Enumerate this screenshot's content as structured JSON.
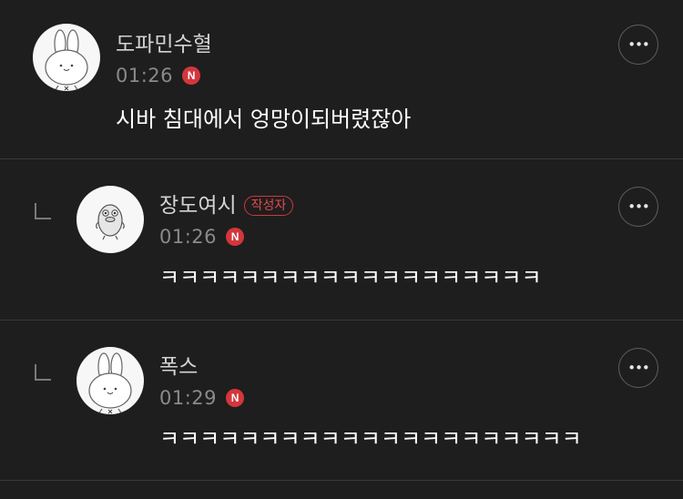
{
  "comments": [
    {
      "author": "도파민수혈",
      "time": "01:26",
      "badge": "N",
      "text": "시바 침대에서 엉망이되버렸잖아",
      "avatar": "bunny-avatar",
      "more_icon": "•••"
    },
    {
      "author": "장도여시",
      "author_tag": "작성자",
      "time": "01:26",
      "badge": "N",
      "text": "ㅋㅋㅋㅋㅋㅋㅋㅋㅋㅋㅋㅋㅋㅋㅋㅋㅋㅋㅋ",
      "avatar": "duck-avatar",
      "more_icon": "•••"
    },
    {
      "author": "폭스",
      "time": "01:29",
      "badge": "N",
      "text": "ㅋㅋㅋㅋㅋㅋㅋㅋㅋㅋㅋㅋㅋㅋㅋㅋㅋㅋㅋㅋㅋ",
      "avatar": "bunny-avatar",
      "more_icon": "•••"
    }
  ],
  "colors": {
    "background": "#1e1e1e",
    "new_badge": "#d3363c",
    "author_tag": "#e14b50",
    "divider": "#3a3a3a"
  }
}
